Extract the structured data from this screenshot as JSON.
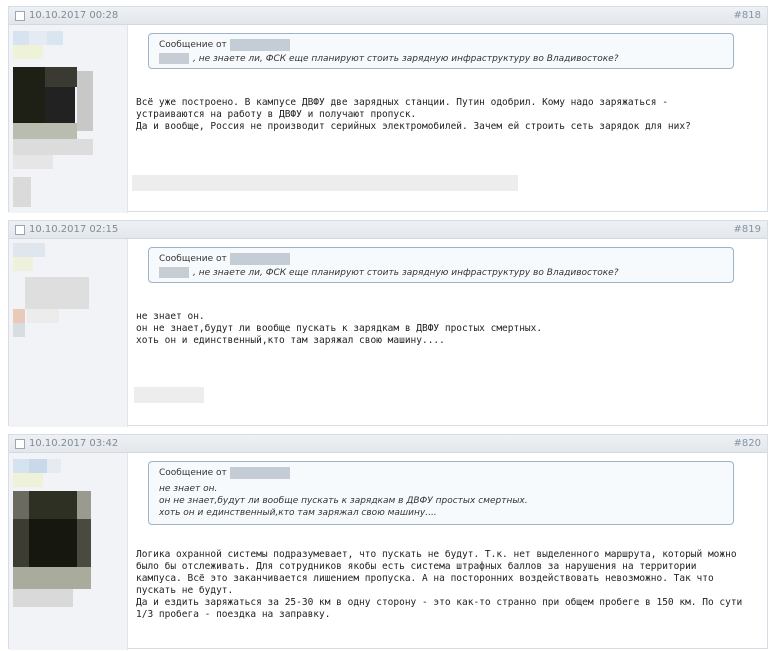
{
  "posts": [
    {
      "date": "10.10.2017 00:28",
      "number": "#818",
      "quote": {
        "label": "Сообщение от",
        "text": ", не знаете ли, ФСК еще планируют стоить зарядную инфраструктуру во Владивостоке?"
      },
      "message": "Всё уже построено. В кампусе ДВФУ две зарядных станции. Путин одобрил. Кому надо заряжаться -\nустраиваются на работу в ДВФУ и получают пропуск.\nДа и вообще, Россия не производит серийных электромобилей. Зачем ей строить сеть зарядок для них?"
    },
    {
      "date": "10.10.2017 02:15",
      "number": "#819",
      "quote": {
        "label": "Сообщение от",
        "text": ", не знаете ли, ФСК еще планируют стоить зарядную инфраструктуру во Владивостоке?"
      },
      "message": "не знает он.\nон не знает,будут ли вообще пускать к зарядкам в ДВФУ простых смертных.\nхоть он и единственный,кто там заряжал свою машину...."
    },
    {
      "date": "10.10.2017 03:42",
      "number": "#820",
      "quote": {
        "label": "Сообщение от",
        "lines": [
          "не знает он.",
          "он не знает,будут ли вообще пускать к зарядкам в ДВФУ простых смертных.",
          "хоть он и единственный,кто там заряжал свою машину...."
        ]
      },
      "message": "Логика охранной системы подразумевает, что пускать не будут. Т.к. нет выделенного маршрута, который можно\nбыло бы отслеживать. Для сотрудников якобы есть система штрафных баллов за нарушения на территории\nкампуса. Всё это заканчивается лишением пропуска. А на посторонних воздействовать невозможно. Так что\nпускать не будут.\nДа и ездить заряжаться за 25-30 км в одну сторону - это как-то странно при общем пробеге в 150 км. По сути\n1/3 пробега - поездка на заправку."
    }
  ]
}
